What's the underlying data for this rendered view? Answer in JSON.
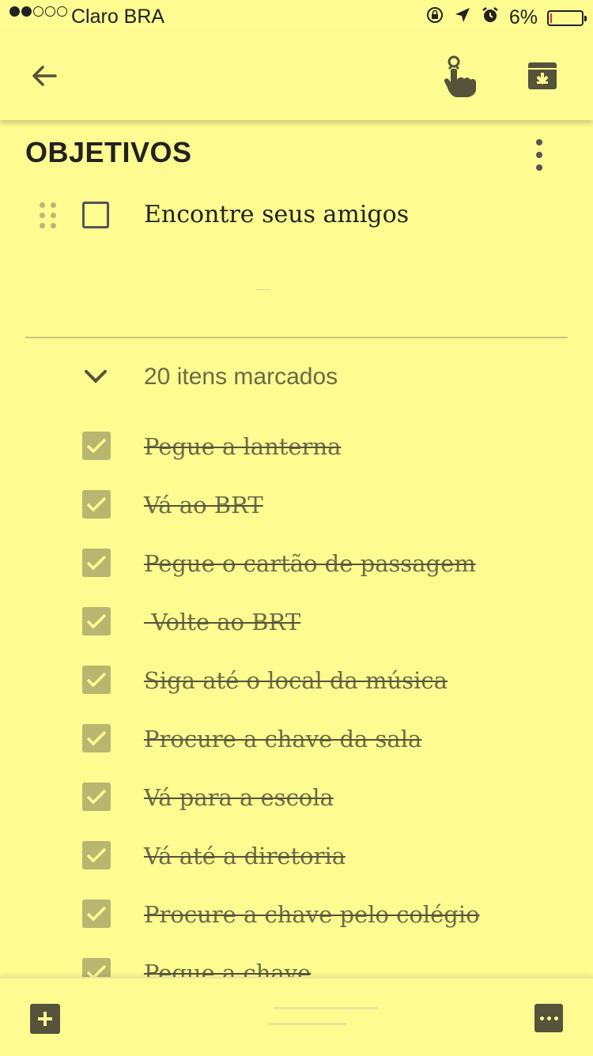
{
  "status_bar": {
    "carrier": "Claro BRA",
    "battery_percent": "6%",
    "battery_level": 0.06,
    "signal_bars_filled": 2,
    "signal_bars_total": 5
  },
  "toolbar": {
    "back_icon": "arrow-left-icon",
    "reminder_icon": "reminder-finger-icon",
    "archive_icon": "archive-icon"
  },
  "note": {
    "title": "OBJETIVOS",
    "menu_icon": "more-vert-icon",
    "unchecked_items": [
      {
        "text": "Encontre seus amigos"
      }
    ],
    "checked_header": "20 itens marcados",
    "checked_items": [
      {
        "text": "Pegue a lanterna"
      },
      {
        "text": "Vá ao BRT"
      },
      {
        "text": "Pegue o cartão de passagem"
      },
      {
        "text": " Volte ao BRT"
      },
      {
        "text": "Siga até o local da música"
      },
      {
        "text": "Procure a chave da sala"
      },
      {
        "text": "Vá para a escola"
      },
      {
        "text": "Vá até a diretoria"
      },
      {
        "text": "Procure a chave pelo colégio"
      },
      {
        "text": "Pegue a chave"
      }
    ]
  },
  "bottom_bar": {
    "add_icon": "add-box-icon",
    "more_icon": "more-horiz-icon"
  },
  "colors": {
    "background": "#fefb91",
    "checked_box": "#b9b66f",
    "dark_icon": "#55533a"
  }
}
